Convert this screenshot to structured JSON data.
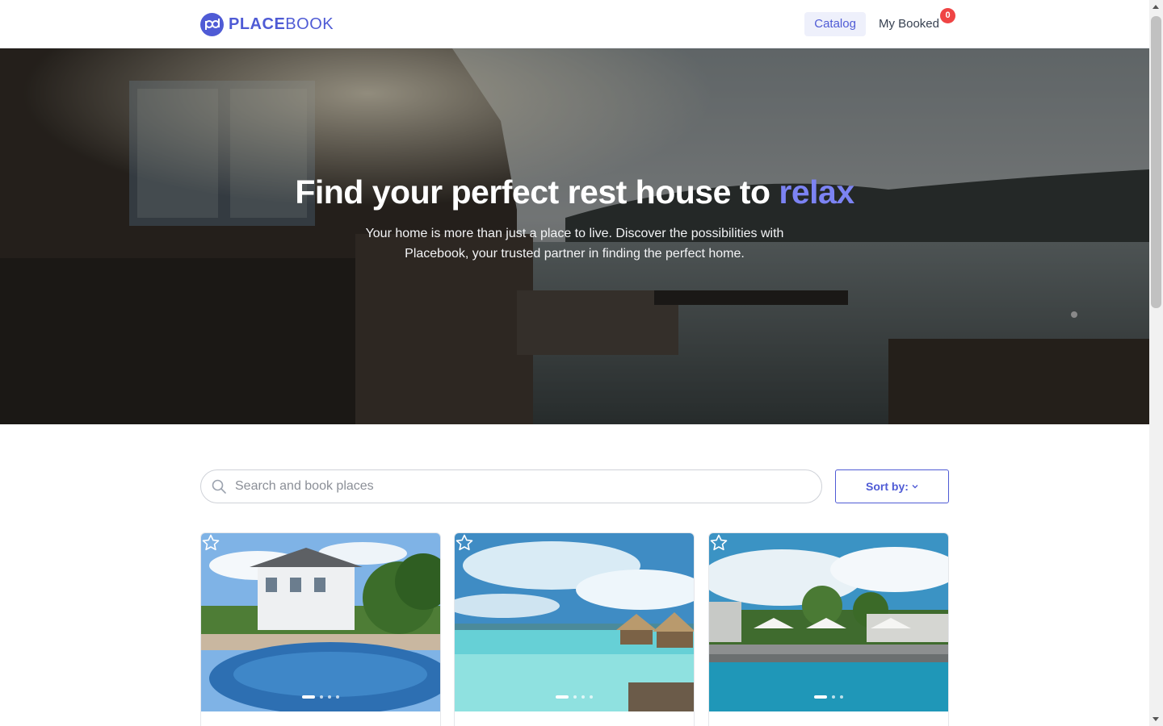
{
  "brand": {
    "bold": "PLACE",
    "light": "BOOK",
    "accent_color": "#4f5bd5"
  },
  "nav": {
    "catalog": "Catalog",
    "booked": "My Booked",
    "booked_count": "0"
  },
  "hero": {
    "title_main": "Find your perfect rest house to ",
    "title_accent": "relax",
    "subtitle": "Your home is more than just a place to live. Discover the possibilities with Placebook, your trusted partner in finding the perfect home."
  },
  "search": {
    "placeholder": "Search and book places",
    "value": ""
  },
  "sort": {
    "label": "Sort by:"
  },
  "cards": [
    {
      "scene": "house-pool",
      "favorite_icon": "star-outline-icon",
      "slides": 4,
      "active_slide": 1
    },
    {
      "scene": "tropical-bungalows",
      "favorite_icon": "star-outline-icon",
      "slides": 4,
      "active_slide": 1
    },
    {
      "scene": "resort-pool",
      "favorite_icon": "star-outline-icon",
      "slides": 3,
      "active_slide": 1
    }
  ]
}
